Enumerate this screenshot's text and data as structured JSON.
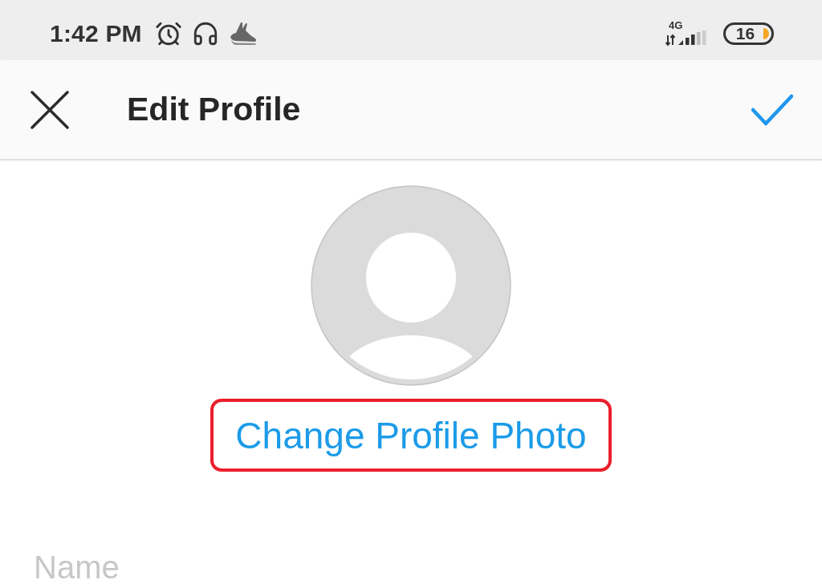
{
  "status_bar": {
    "time": "1:42 PM",
    "network_type": "4G",
    "battery": "16"
  },
  "app_bar": {
    "title": "Edit Profile"
  },
  "profile_photo": {
    "action": "Change Profile Photo",
    "highlighted": true
  },
  "fields": [
    {
      "placeholder": "Name"
    }
  ]
}
